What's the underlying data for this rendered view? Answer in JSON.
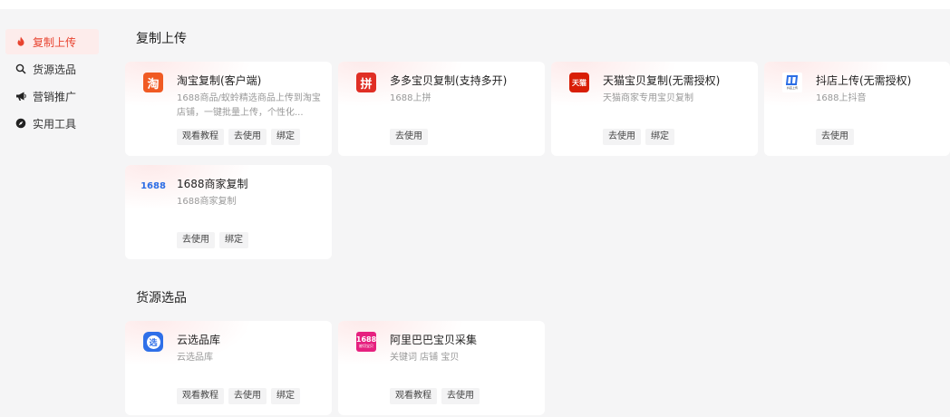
{
  "sidebar": {
    "items": [
      {
        "label": "复制上传",
        "icon": "flame-icon"
      },
      {
        "label": "货源选品",
        "icon": "search-icon"
      },
      {
        "label": "营销推广",
        "icon": "megaphone-icon"
      },
      {
        "label": "实用工具",
        "icon": "compass-icon"
      }
    ]
  },
  "sections": {
    "copy_upload": {
      "title": "复制上传",
      "cards": [
        {
          "title": "淘宝复制(客户端)",
          "desc": "1688商品/蚁蛉精选商品上传到淘宝店铺，一键批量上传，个性化...",
          "logo_text": "淘",
          "buttons": [
            "观看教程",
            "去使用",
            "绑定"
          ]
        },
        {
          "title": "多多宝贝复制(支持多开)",
          "desc": "1688上拼",
          "logo_text": "拼",
          "buttons": [
            "去使用"
          ]
        },
        {
          "title": "天猫宝贝复制(无需授权)",
          "desc": "天猫商家专用宝贝复制",
          "logo_text": "天猫",
          "buttons": [
            "去使用",
            "绑定"
          ]
        },
        {
          "title": "抖店上传(无需授权)",
          "desc": "1688上抖音",
          "logo_text": "抖店上传",
          "buttons": [
            "去使用"
          ]
        },
        {
          "title": "1688商家复制",
          "desc": "1688商家复制",
          "logo_text": "1688",
          "buttons": [
            "去使用",
            "绑定"
          ]
        }
      ]
    },
    "sourcing": {
      "title": "货源选品",
      "cards": [
        {
          "title": "云选品库",
          "desc": "云选品库",
          "logo_text": "选",
          "buttons": [
            "观看教程",
            "去使用",
            "绑定"
          ]
        },
        {
          "title": "阿里巴巴宝贝采集",
          "desc": "关键词 店铺 宝贝",
          "logo_text": "1688",
          "logo_sub": "被切宝贝",
          "buttons": [
            "观看教程",
            "去使用"
          ]
        }
      ]
    }
  },
  "colors": {
    "accent": "#e8432f",
    "taobao": "#f05a23",
    "pdd": "#e02e24",
    "tmall": "#d81e06",
    "douyin": "#2b6de5",
    "blue1688": "#2b6de5",
    "cloud": "#2f6fe8",
    "ali1688": "#e6217f"
  }
}
